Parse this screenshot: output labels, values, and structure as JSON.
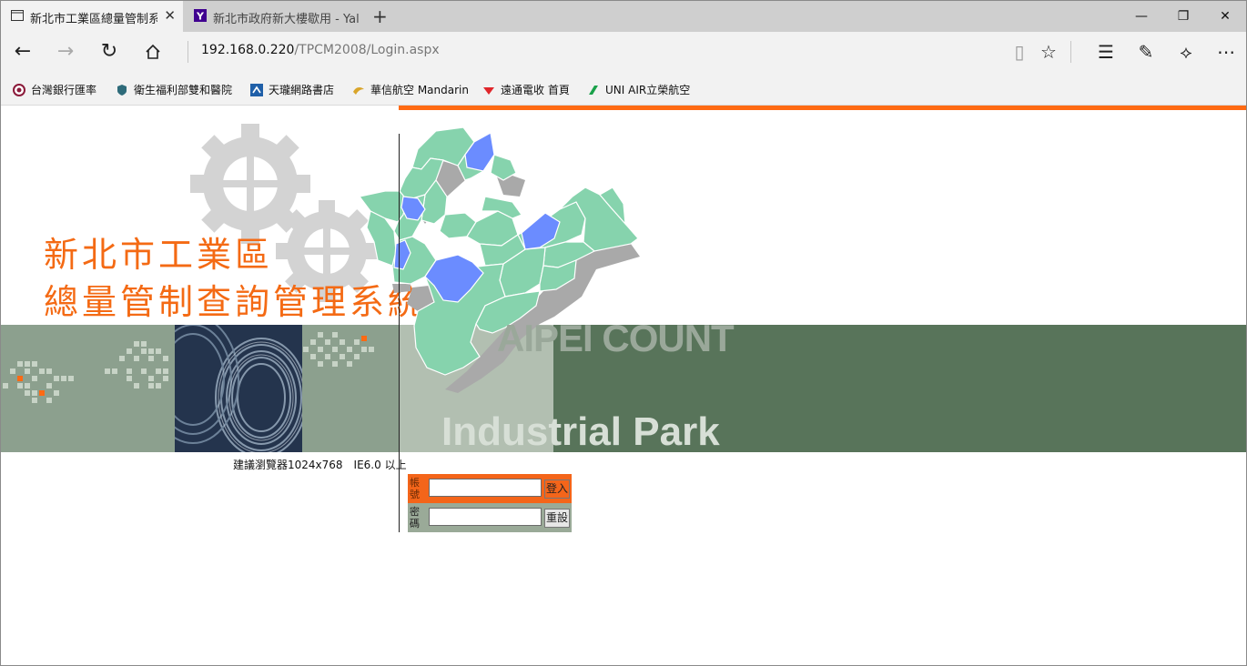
{
  "browser": {
    "tabs": [
      {
        "title": "新北市工業區總量管制系",
        "active": true
      },
      {
        "title": "新北市政府新大樓歇用 - Yal",
        "active": false
      }
    ],
    "address": {
      "host": "192.168.0.220",
      "path": "/TPCM2008/Login.aspx"
    },
    "favorites": [
      {
        "label": "台灣銀行匯率",
        "icon": "bank-of-taiwan-icon"
      },
      {
        "label": "衛生福利部雙和醫院",
        "icon": "hospital-shield-icon"
      },
      {
        "label": "天瓏網路書店",
        "icon": "bookstore-icon"
      },
      {
        "label": "華信航空 Mandarin",
        "icon": "mandarin-airlines-icon"
      },
      {
        "label": "遠通電收 首頁",
        "icon": "fetc-icon"
      },
      {
        "label": "UNI AIR立榮航空",
        "icon": "uni-air-icon"
      }
    ]
  },
  "page": {
    "title_line1": "新北市工業區",
    "title_line2": "總量管制查詢管理系統",
    "banner_line1": "AIPEI COUNT",
    "banner_line2": "Industrial Park",
    "browser_note": "建議瀏覽器1024x768　IE6.0 以上",
    "login": {
      "account_label": "帳號",
      "password_label": "密碼",
      "login_button": "登入",
      "reset_button": "重設",
      "account_value": "",
      "password_value": ""
    }
  },
  "colors": {
    "accent_orange": "#ff6a13",
    "band_green_dark": "#58745a",
    "band_green_light": "#8ca08e",
    "map_district": "#86d3ad",
    "map_highlight": "#6b8cff"
  }
}
